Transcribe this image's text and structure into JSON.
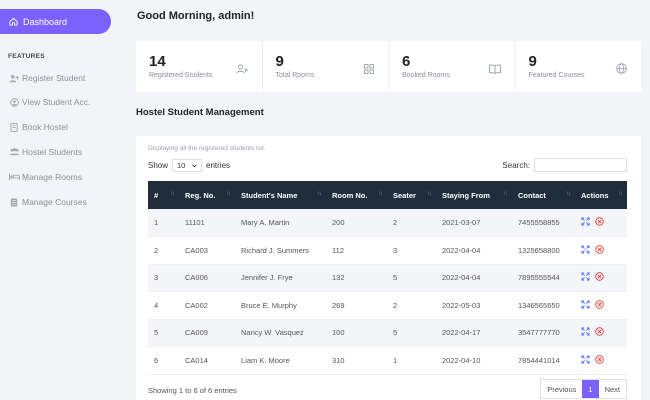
{
  "sidebar": {
    "dashboard_label": "Dashboard",
    "section_label": "FEATURES",
    "items": [
      {
        "label": "Register Student",
        "icon": "user-plus-icon"
      },
      {
        "label": "View Student Acc.",
        "icon": "user-circle-icon"
      },
      {
        "label": "Book Hostel",
        "icon": "book-icon"
      },
      {
        "label": "Hostel Students",
        "icon": "users-icon"
      },
      {
        "label": "Manage Rooms",
        "icon": "bed-icon"
      },
      {
        "label": "Manage Courses",
        "icon": "list-icon"
      }
    ]
  },
  "header": {
    "greeting": "Good Morning, admin!"
  },
  "stats": [
    {
      "value": "14",
      "label": "Registered Students",
      "icon": "user-plus-icon"
    },
    {
      "value": "9",
      "label": "Total Rooms",
      "icon": "grid-icon"
    },
    {
      "value": "6",
      "label": "Booked Rooms",
      "icon": "open-book-icon"
    },
    {
      "value": "9",
      "label": "Featured Courses",
      "icon": "globe-icon"
    }
  ],
  "main": {
    "section_title": "Hostel Student Management",
    "subtitle": "Displaying all the registered students list.",
    "show_label": "Show",
    "show_value": "10",
    "entries_label": "entries",
    "search_label": "Search:",
    "columns": [
      "#",
      "Reg. No.",
      "Student's Name",
      "Room No.",
      "Seater",
      "Staying From",
      "Contact",
      "Actions"
    ],
    "rows": [
      [
        "1",
        "11101",
        "Mary A. Martin",
        "200",
        "2",
        "2021-03-07",
        "7455558855"
      ],
      [
        "2",
        "CA003",
        "Richard J. Summers",
        "112",
        "3",
        "2022-04-04",
        "1325658800"
      ],
      [
        "3",
        "CA006",
        "Jennifer J. Frye",
        "132",
        "5",
        "2022-04-04",
        "7895555544"
      ],
      [
        "4",
        "CA002",
        "Bruce E. Murphy",
        "269",
        "2",
        "2022-05-03",
        "1346565650"
      ],
      [
        "5",
        "CA009",
        "Nancy W. Vasquez",
        "100",
        "5",
        "2022-04-17",
        "3547777770"
      ],
      [
        "6",
        "CA014",
        "Liam K. Moore",
        "310",
        "1",
        "2022-04-10",
        "7854441014"
      ]
    ],
    "showing_text": "Showing 1 to 6 of 6 entries",
    "pagination": {
      "previous": "Previous",
      "current": "1",
      "next": "Next"
    }
  },
  "colors": {
    "accent": "#7b61ff",
    "table_header": "#1f2d3d",
    "action_expand": "#4a6cf7",
    "action_delete": "#e53935"
  }
}
